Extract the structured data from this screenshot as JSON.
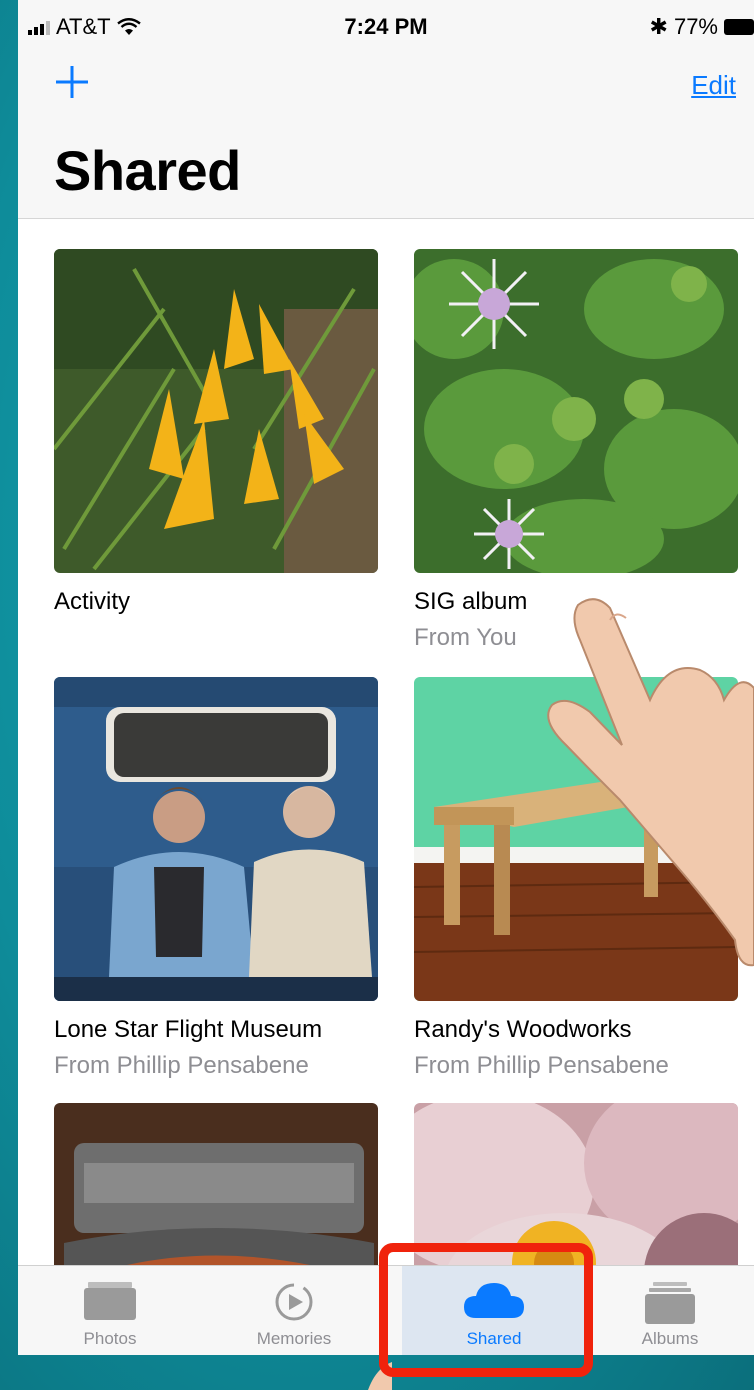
{
  "status_bar": {
    "carrier": "AT&T",
    "time": "7:24 PM",
    "battery": "77%"
  },
  "nav": {
    "edit_label": "Edit",
    "title": "Shared"
  },
  "albums": [
    {
      "title": "Activity",
      "subtitle": ""
    },
    {
      "title": "SIG album",
      "subtitle": "From You"
    },
    {
      "title": "Lone Star Flight Museum",
      "subtitle": "From Phillip Pensabene"
    },
    {
      "title": "Randy's Woodworks",
      "subtitle": "From Phillip Pensabene"
    }
  ],
  "tabs": [
    {
      "label": "Photos",
      "icon": "photos-icon"
    },
    {
      "label": "Memories",
      "icon": "memories-icon"
    },
    {
      "label": "Shared",
      "icon": "cloud-icon"
    },
    {
      "label": "Albums",
      "icon": "albums-icon"
    }
  ],
  "colors": {
    "accent": "#0a7aff",
    "highlight": "#f0230c",
    "background": "#0e8c9a"
  }
}
